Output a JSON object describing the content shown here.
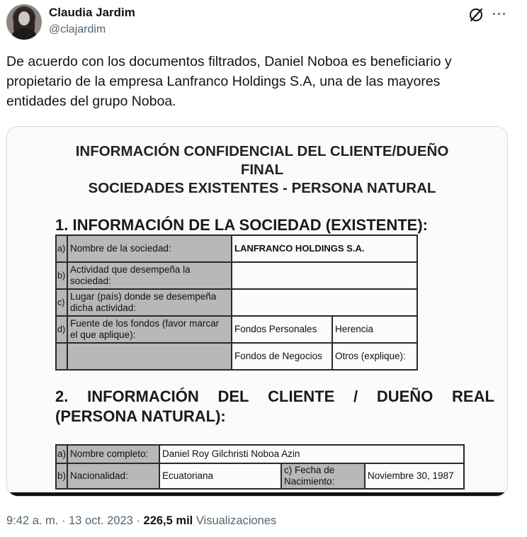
{
  "author": {
    "name": "Claudia Jardim",
    "handle": "@clajardim"
  },
  "icons": {
    "grok": "grok-icon",
    "more": "more-icon"
  },
  "tweet": {
    "lines": [
      "De acuerdo con los documentos filtrados, Daniel Noboa es beneficiario y",
      "propietario de la empresa Lanfranco Holdings S.A, una de las mayores",
      "entidades del grupo Noboa."
    ]
  },
  "document": {
    "title_line1": "INFORMACIÓN CONFIDENCIAL DEL CLIENTE/DUEÑO",
    "title_line2": "FINAL",
    "title_line3": "SOCIEDADES EXISTENTES - PERSONA NATURAL",
    "section1": "1.  INFORMACIÓN DE LA SOCIEDAD (EXISTENTE):",
    "table1": {
      "row_a": {
        "letter": "a)",
        "label": "Nombre de la sociedad:",
        "value": "LANFRANCO HOLDINGS S.A."
      },
      "row_b": {
        "letter": "b)",
        "label": "Actividad que desempeña la sociedad:",
        "value": ""
      },
      "row_c": {
        "letter": "c)",
        "label": "Lugar (país) donde se desempeña dicha actividad:",
        "value": ""
      },
      "row_d": {
        "letter": "d)",
        "label": "Fuente de los fondos (favor marcar el que aplique):",
        "opt1": "Fondos Personales",
        "opt2": "Herencia"
      },
      "row_e": {
        "opt3": "Fondos de Negocios",
        "opt4": "Otros (explique):"
      }
    },
    "section2_words": [
      "2.",
      "INFORMACIÓN",
      "DEL",
      "CLIENTE",
      "/",
      "DUEÑO",
      "REAL"
    ],
    "section2_line2": "(PERSONA NATURAL):",
    "table2": {
      "row_a": {
        "letter": "a)",
        "label": "Nombre completo:",
        "value": "Daniel Roy Gilchristi Noboa Azin"
      },
      "row_b": {
        "letter": "b)",
        "label": "Nacionalidad:",
        "value": "Ecuatoriana",
        "label2": "c) Fecha de Nacimiento:",
        "value2": "Noviembre 30, 1987"
      }
    }
  },
  "footer": {
    "time": "9:42 a. m. · 13 oct. 2023 · ",
    "views_count": "226,5 mil",
    "views_label": " Visualizaciones"
  }
}
